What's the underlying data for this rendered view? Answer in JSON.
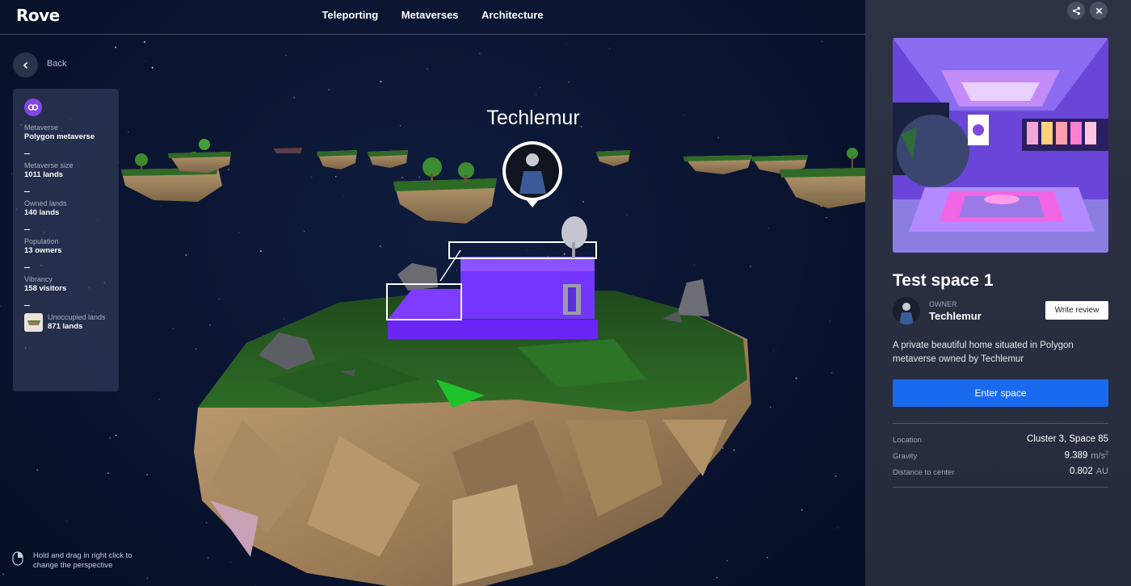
{
  "app": {
    "logo": "Rove"
  },
  "nav": {
    "items": [
      "Teleporting",
      "Metaverses",
      "Architecture"
    ]
  },
  "back": {
    "label": "Back"
  },
  "stats": {
    "metaverse_label": "Metaverse",
    "metaverse_value": "Polygon metaverse",
    "size_label": "Metaverse size",
    "size_value": "1011 lands",
    "owned_label": "Owned lands",
    "owned_value": "140 lands",
    "population_label": "Population",
    "population_value": "13 owners",
    "vibrancy_label": "Vibrancy",
    "vibrancy_value": "158 visitors",
    "unoccupied_label": "Unoccupied lands",
    "unoccupied_value": "871 lands"
  },
  "scene": {
    "owner_label": "Techlemur",
    "hint": "Hold and drag in right click to change the perspective"
  },
  "panel": {
    "title": "Test space 1",
    "owner_caption": "OWNER",
    "owner_name": "Techlemur",
    "write_review": "Write review",
    "description": "A private beautiful home situated in Polygon metaverse owned by Techlemur",
    "enter_button": "Enter space",
    "location_label": "Location",
    "location_value": "Cluster 3, Space 85",
    "gravity_label": "Gravity",
    "gravity_value": "9.389",
    "gravity_unit": "m/s",
    "gravity_unit_exp": "2",
    "distance_label": "Distance to center",
    "distance_value": "0.802",
    "distance_unit": "AU"
  },
  "icons": {
    "back": "chevron-left-icon",
    "share": "share-icon",
    "close": "close-icon",
    "metaverse": "polygon-logo-icon",
    "mouse": "mouse-icon"
  },
  "colors": {
    "accent": "#1a6af0",
    "polygon": "#8247e5",
    "panel_bg": "#2d3345",
    "scene_bg": "#0a1430"
  }
}
